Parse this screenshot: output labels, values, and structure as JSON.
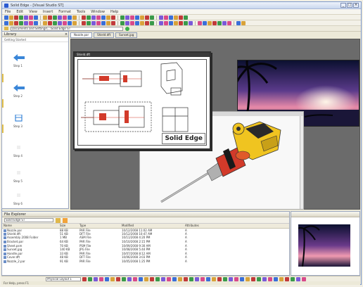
{
  "window": {
    "title": "Solid Edge - [Visual Studio ST]",
    "controls": [
      "_",
      "□",
      "×"
    ]
  },
  "menu": {
    "items": [
      "File",
      "Edit",
      "View",
      "Insert",
      "Format",
      "Tools",
      "Window",
      "Help"
    ]
  },
  "toolbar": {
    "combo_value": "Documents and Settings\\...\\Solid Edge ST",
    "icon_colors": [
      "#3a6fd8",
      "#d8a23a",
      "#c23a3a",
      "#3a9a4a",
      "#7a5ad8",
      "#d84a8a"
    ]
  },
  "left_pane": {
    "title": "Library",
    "close": "×",
    "sub": "Getting Started",
    "steps": [
      {
        "label": "Step 1",
        "icon": "blue-arrow-icon"
      },
      {
        "label": "Step 2",
        "icon": "blue-arrow-icon"
      },
      {
        "label": "Step 3",
        "icon": "part-icon"
      },
      {
        "label": "Step 4",
        "icon": "placeholder-icon"
      },
      {
        "label": "Step 5",
        "icon": "placeholder-icon"
      },
      {
        "label": "Step 6",
        "icon": "placeholder-icon"
      }
    ]
  },
  "tabs": [
    {
      "label": "Nozzle.par",
      "active": true
    },
    {
      "label": "Shield.dft",
      "active": false
    },
    {
      "label": "Sunset.jpg",
      "active": false
    }
  ],
  "drawing_window": {
    "title": "Shield.dft",
    "watermark": "Solid Edge"
  },
  "explorer": {
    "title": "File Explorer",
    "path": "Solid Edge ST",
    "columns": [
      "Name",
      "Size",
      "Type",
      "Modified",
      "Attributes"
    ],
    "rows": [
      {
        "name": "Nozzle.par",
        "size": "88 KB",
        "type": "PAR File",
        "modified": "10/12/2008 11:02 AM",
        "attr": "A"
      },
      {
        "name": "Shield.dft",
        "size": "51 KB",
        "type": "DFT File",
        "modified": "10/12/2008 10:47 AM",
        "attr": "A"
      },
      {
        "name": "Assembly 2008 Folder",
        "size": "1 MB",
        "type": "ASM File",
        "modified": "10/11/2008 4:20 PM",
        "attr": "A"
      },
      {
        "name": "Bracket.par",
        "size": "64 KB",
        "type": "PAR File",
        "modified": "10/10/2008 2:15 PM",
        "attr": "A"
      },
      {
        "name": "Sheet.psm",
        "size": "70 KB",
        "type": "PSM File",
        "modified": "10/09/2008 9:30 AM",
        "attr": "A"
      },
      {
        "name": "Sunset.jpg",
        "size": "140 KB",
        "type": "JPG File",
        "modified": "10/08/2008 5:44 PM",
        "attr": "A"
      },
      {
        "name": "Handle.par",
        "size": "33 KB",
        "type": "PAR File",
        "modified": "10/07/2008 8:12 AM",
        "attr": "A"
      },
      {
        "name": "Cover.dft",
        "size": "48 KB",
        "type": "DFT File",
        "modified": "10/06/2008 3:03 PM",
        "attr": "A"
      },
      {
        "name": "Nozzle_2.par",
        "size": "91 KB",
        "type": "PAR File",
        "modified": "10/05/2008 1:25 PM",
        "attr": "A"
      }
    ]
  },
  "bottom_bar": {
    "combo_value": "Physical Layout 1"
  },
  "status": {
    "text": "For Help, press F1"
  },
  "colors": {
    "accent_blue": "#3a86d8",
    "drawing_red": "#d23a2a",
    "model_yellow": "#f0c420",
    "highlight_orange": "#f2a33a"
  }
}
